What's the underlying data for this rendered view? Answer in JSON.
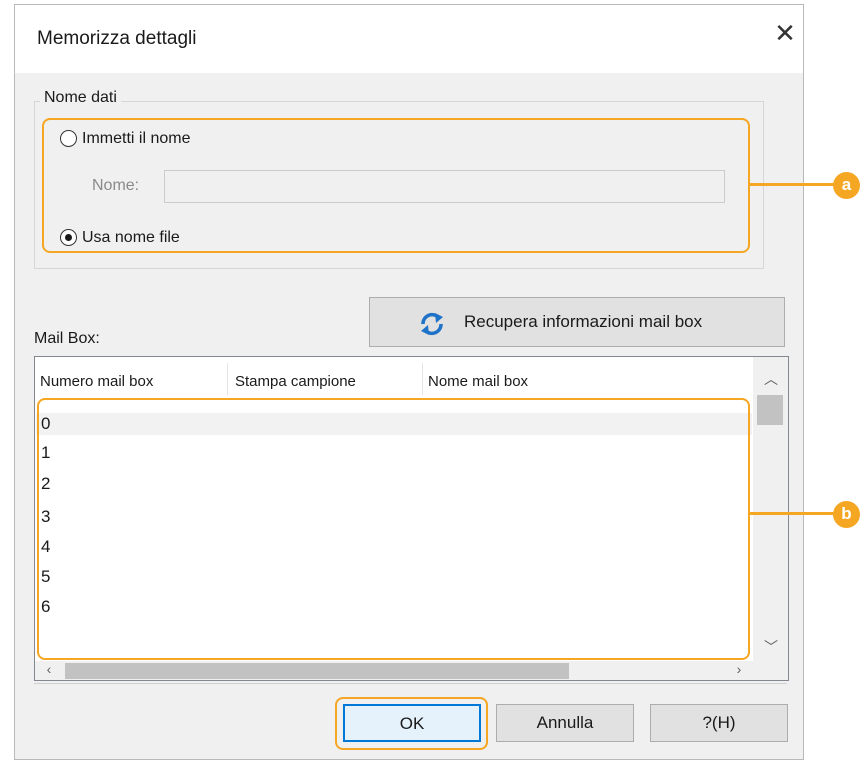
{
  "dialog": {
    "title": "Memorizza dettagli",
    "close_icon": "close-icon"
  },
  "name_group": {
    "legend": "Nome dati",
    "enter_name_label": "Immetti il nome",
    "name_field_label": "Nome:",
    "name_value": "",
    "use_filename_label": "Usa nome file",
    "selected_option": "use_filename"
  },
  "mailbox": {
    "label": "Mail Box:",
    "fetch_button_label": "Recupera informazioni mail box",
    "fetch_icon": "refresh-icon",
    "columns": [
      "Numero mail box",
      "Stampa campione",
      "Nome mail box"
    ],
    "rows": [
      "0",
      "1",
      "2",
      "3",
      "4",
      "5",
      "6"
    ],
    "selected_row": "0"
  },
  "buttons": {
    "ok": "OK",
    "cancel": "Annulla",
    "help": "?(H)"
  },
  "callouts": {
    "a": "a",
    "b": "b"
  },
  "colors": {
    "callout": "#f5a623",
    "dialog_bg": "#f0f0f0",
    "focus_border": "#0078d7"
  }
}
